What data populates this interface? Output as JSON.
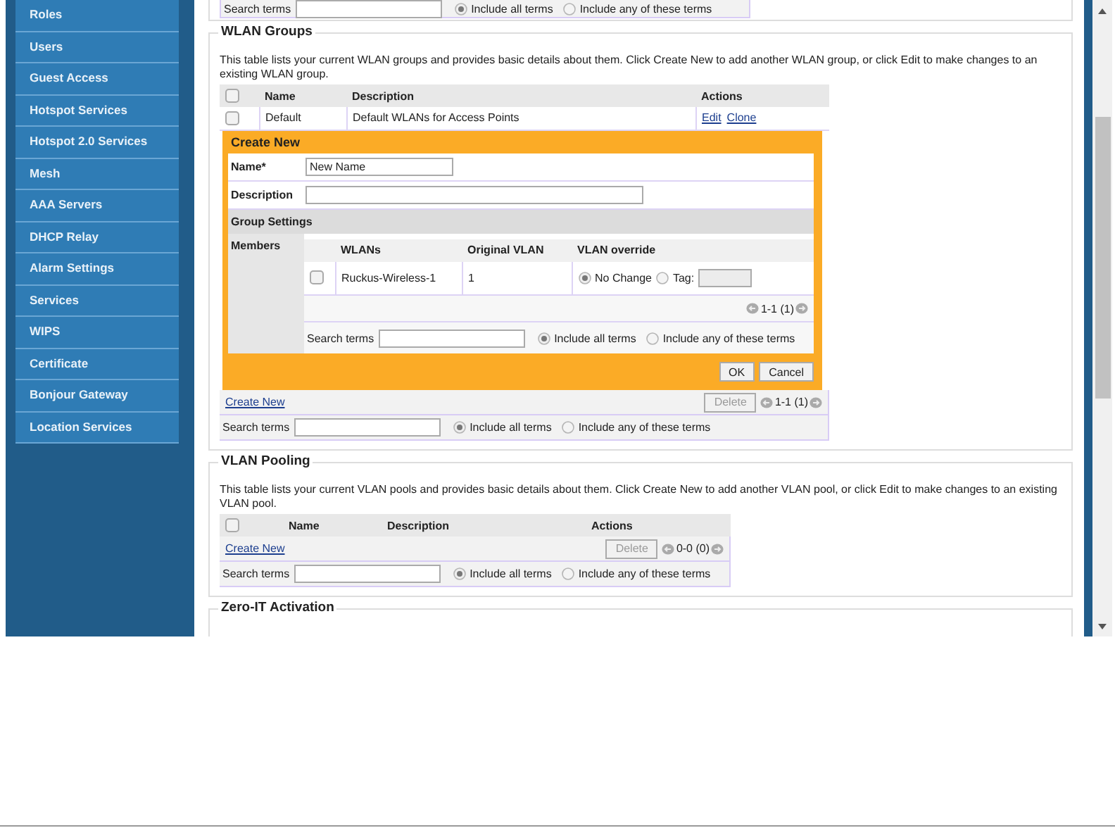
{
  "sidebar": {
    "items": [
      {
        "label": "Roles"
      },
      {
        "label": "Users"
      },
      {
        "label": "Guest Access"
      },
      {
        "label": "Hotspot Services"
      },
      {
        "label": "Hotspot 2.0 Services"
      },
      {
        "label": "Mesh"
      },
      {
        "label": "AAA Servers"
      },
      {
        "label": "DHCP Relay"
      },
      {
        "label": "Alarm Settings"
      },
      {
        "label": "Services"
      },
      {
        "label": "WIPS"
      },
      {
        "label": "Certificate"
      },
      {
        "label": "Bonjour Gateway"
      },
      {
        "label": "Location Services"
      }
    ]
  },
  "top_search": {
    "label": "Search terms",
    "options": [
      {
        "label": "Include all terms",
        "selected": true
      },
      {
        "label": "Include any of these terms",
        "selected": false
      }
    ]
  },
  "wlan_groups": {
    "title": "WLAN Groups",
    "description": "This table lists your current WLAN groups and provides basic details about them. Click Create New to add another WLAN group, or click Edit to make changes to an existing WLAN group.",
    "table": {
      "select_all": false,
      "columns": [
        "Name",
        "Description",
        "Actions"
      ],
      "rows": [
        {
          "checked": false,
          "name": "Default",
          "description": "Default WLANs for Access Points",
          "actions": [
            "Edit",
            "Clone"
          ]
        }
      ]
    },
    "create_new": {
      "title": "Create New",
      "name_label": "Name*",
      "name_value": "New Name",
      "description_label": "Description",
      "group_settings": "Group Settings",
      "members_label": "Members",
      "members": {
        "columns": [
          "WLANs",
          "Original VLAN",
          "VLAN override"
        ],
        "rows": [
          {
            "checked": false,
            "wlan": "Ruckus-Wireless-1",
            "original_vlan": "1",
            "override": [
              {
                "label": "No Change",
                "selected": true
              },
              {
                "label": "Tag:",
                "selected": false
              }
            ]
          }
        ],
        "pager": "1-1 (1)",
        "search": {
          "label": "Search terms",
          "options": [
            {
              "label": "Include all terms",
              "selected": true
            },
            {
              "label": "Include any of these terms",
              "selected": false
            }
          ]
        }
      },
      "buttons": [
        "OK",
        "Cancel"
      ]
    },
    "create_link": "Create New",
    "delete": {
      "label": "Delete",
      "disabled": true
    },
    "pager": "1-1 (1)",
    "search": {
      "label": "Search terms",
      "options": [
        {
          "label": "Include all terms",
          "selected": true
        },
        {
          "label": "Include any of these terms",
          "selected": false
        }
      ]
    }
  },
  "vlan_pooling": {
    "title": "VLAN Pooling",
    "description": "This table lists your current VLAN pools and provides basic details about them. Click Create New to add another VLAN pool, or click Edit to make changes to an existing VLAN pool.",
    "table": {
      "select_all": false,
      "columns": [
        "Name",
        "Description",
        "Actions"
      ]
    },
    "create_link": "Create New",
    "delete": {
      "label": "Delete",
      "disabled": true
    },
    "pager": "0-0 (0)",
    "search": {
      "label": "Search terms",
      "options": [
        {
          "label": "Include all terms",
          "selected": true
        },
        {
          "label": "Include any of these terms",
          "selected": false
        }
      ]
    }
  },
  "zero_it": {
    "title": "Zero-IT Activation"
  }
}
